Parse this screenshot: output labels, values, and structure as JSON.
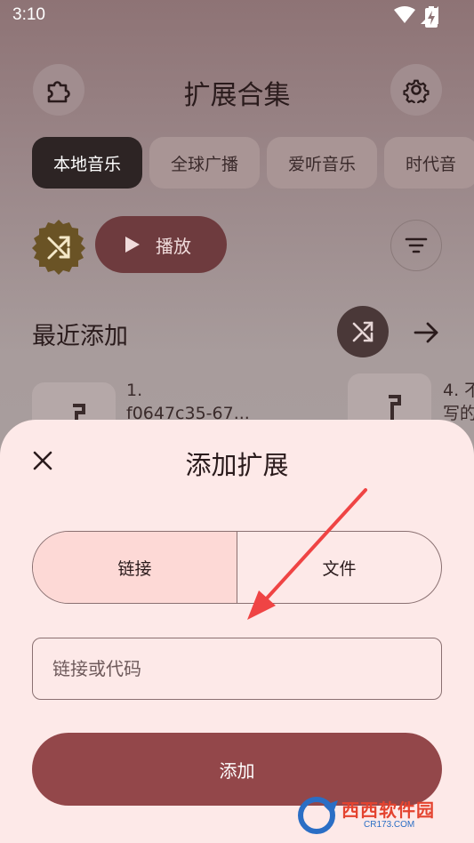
{
  "status": {
    "time": "3:10"
  },
  "header": {
    "title": "扩展合集"
  },
  "chips": [
    {
      "label": "本地音乐",
      "active": true
    },
    {
      "label": "全球广播",
      "active": false
    },
    {
      "label": "爱听音乐",
      "active": false
    },
    {
      "label": "时代音",
      "active": false
    }
  ],
  "player": {
    "play_label": "播放"
  },
  "recent": {
    "title": "最近添加",
    "tracks": [
      {
        "title": "1.\nf0647c35-67..."
      },
      {
        "title": "4. 不\n写的"
      }
    ]
  },
  "dialog": {
    "title": "添加扩展",
    "tabs": {
      "link": "链接",
      "file": "文件"
    },
    "input_placeholder": "链接或代码",
    "add_label": "添加"
  },
  "watermark": {
    "brand": "西西软件园",
    "url": "CR173.COM"
  },
  "colors": {
    "accent": "#93474a",
    "sheet_bg": "#fde9e8",
    "annotation_arrow": "#ef4444"
  }
}
